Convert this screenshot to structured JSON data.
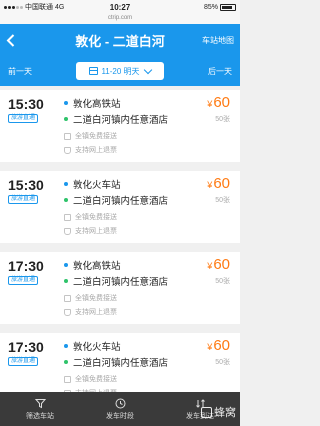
{
  "status_bar": {
    "carrier": "中国联通",
    "network": "4G",
    "time": "10:27",
    "battery": "85%"
  },
  "url": "ctrip.com",
  "header": {
    "title": "敦化 - 二道白河",
    "right_link": "车站地图"
  },
  "date_bar": {
    "prev": "前一天",
    "date": "11-20 明天",
    "next": "后一天"
  },
  "trips": [
    {
      "time": "15:30",
      "badge": "旅游直通",
      "from": "敦化高铁站",
      "to": "二道白河镇内任意酒店",
      "features": [
        "全镇免费接送",
        "支持网上退票"
      ],
      "price": "60",
      "remain": "50张"
    },
    {
      "time": "15:30",
      "badge": "旅游直通",
      "from": "敦化火车站",
      "to": "二道白河镇内任意酒店",
      "features": [
        "全镇免费接送",
        "支持网上退票"
      ],
      "price": "60",
      "remain": "50张"
    },
    {
      "time": "17:30",
      "badge": "旅游直通",
      "from": "敦化高铁站",
      "to": "二道白河镇内任意酒店",
      "features": [
        "全镇免费接送",
        "支持网上退票"
      ],
      "price": "60",
      "remain": "50张"
    },
    {
      "time": "17:30",
      "badge": "旅游直通",
      "from": "敦化火车站",
      "to": "二道白河镇内任意酒店",
      "features": [
        "全镇免费接送",
        "支持网上退票"
      ],
      "price": "60",
      "remain": "50张"
    }
  ],
  "currency_symbol": "¥",
  "bottom_bar": {
    "filter": "筛选车站",
    "departure": "发车时段",
    "arrival": "发车到达"
  },
  "watermark": "蜂窝",
  "colors": {
    "primary": "#1a97ec",
    "price": "#ff7a12",
    "from_dot": "#1a97ec",
    "to_dot": "#2ec36a",
    "bottom_bar": "#3a3a3a"
  }
}
